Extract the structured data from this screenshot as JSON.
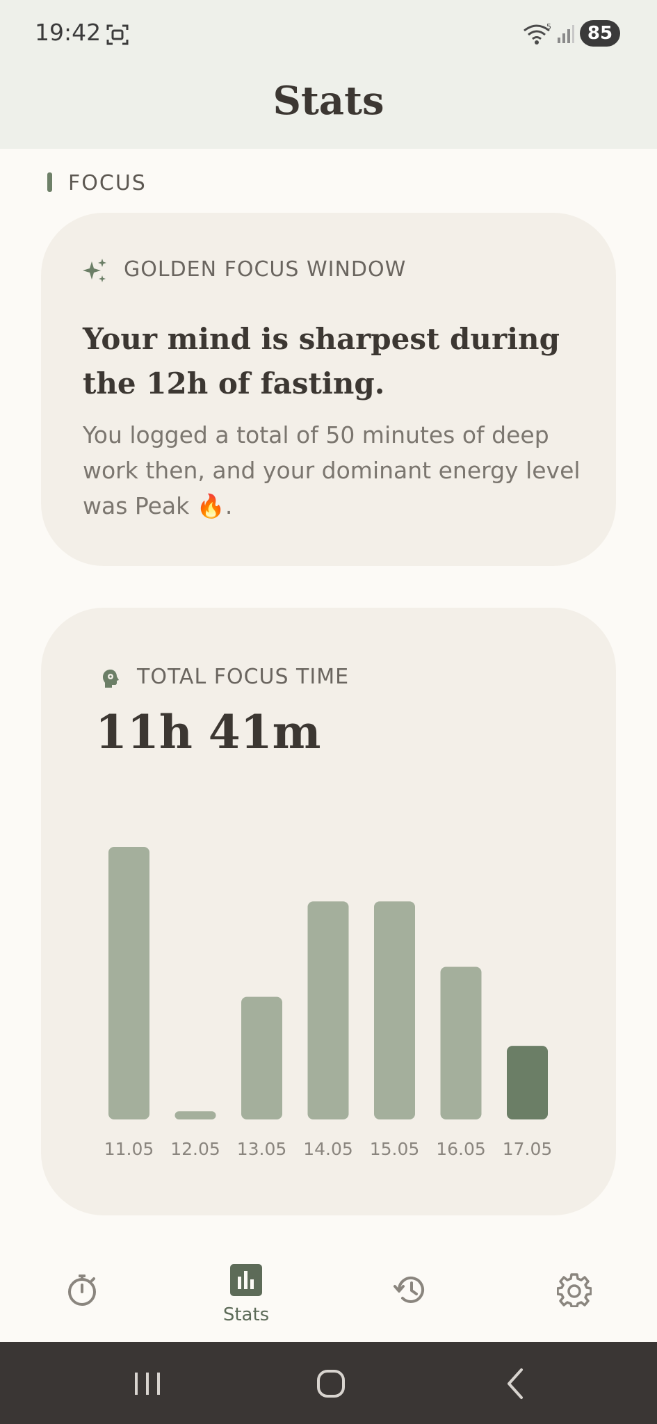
{
  "status_bar": {
    "time": "19:42",
    "battery": "85",
    "icons": [
      "screen-record-icon",
      "wifi-icon",
      "signal-icon"
    ]
  },
  "app": {
    "title": "Stats"
  },
  "section": {
    "title": "FOCUS"
  },
  "golden_card": {
    "icon": "sparkle-icon",
    "label": "GOLDEN FOCUS WINDOW",
    "headline": "Your mind is sharpest during the 12h of fasting.",
    "body": "You logged a total of 50 minutes of deep work then, and your dominant energy level was Peak 🔥."
  },
  "total_card": {
    "icon": "brain-icon",
    "label": "TOTAL FOCUS TIME",
    "value": "11h 41m"
  },
  "chart_data": {
    "type": "bar",
    "categories": [
      "11.05",
      "12.05",
      "13.05",
      "14.05",
      "15.05",
      "16.05",
      "17.05"
    ],
    "values": [
      100,
      3,
      45,
      80,
      80,
      56,
      27
    ],
    "ylim": [
      0,
      100
    ],
    "grid": false,
    "highlight_index": 6,
    "bar_color": "#a4af9c",
    "highlight_color": "#6b7e66"
  },
  "bottom_nav": {
    "items": [
      {
        "id": "timer",
        "icon": "stopwatch-icon",
        "label": "",
        "active": false
      },
      {
        "id": "stats",
        "icon": "bar-chart-icon",
        "label": "Stats",
        "active": true
      },
      {
        "id": "history",
        "icon": "history-icon",
        "label": "",
        "active": false
      },
      {
        "id": "settings",
        "icon": "gear-icon",
        "label": "",
        "active": false
      }
    ]
  },
  "colors": {
    "accent": "#6b7e66",
    "background": "#fcfaf6",
    "card": "#f3efe8",
    "header": "#eef0ea"
  }
}
